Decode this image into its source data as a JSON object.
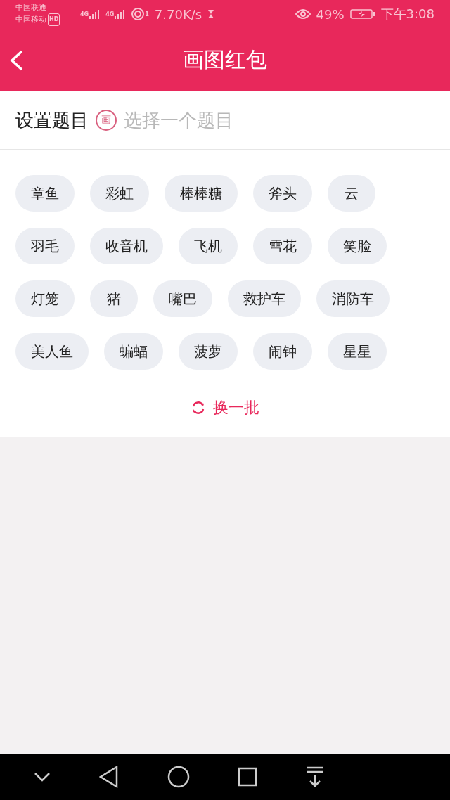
{
  "status_bar": {
    "carrier_1": "中国联通",
    "carrier_2": "中国移动",
    "hd_badge": "HD",
    "network_1": "4G",
    "network_2": "4G",
    "hotspot_count": "1",
    "speed": "7.70K/s",
    "battery": "49%",
    "time": "下午3:08"
  },
  "header": {
    "title": "画图红包"
  },
  "topic": {
    "label": "设置题目",
    "badge": "画",
    "placeholder": "选择一个题目"
  },
  "tag_rows": [
    [
      "章鱼",
      "彩虹",
      "棒棒糖",
      "斧头",
      "云"
    ],
    [
      "羽毛",
      "收音机",
      "飞机",
      "雪花",
      "笑脸"
    ],
    [
      "灯笼",
      "猪",
      "嘴巴",
      "救护车",
      "消防车"
    ],
    [
      "美人鱼",
      "蝙蝠",
      "菠萝",
      "闹钟",
      "星星"
    ]
  ],
  "refresh": {
    "label": "换一批"
  }
}
